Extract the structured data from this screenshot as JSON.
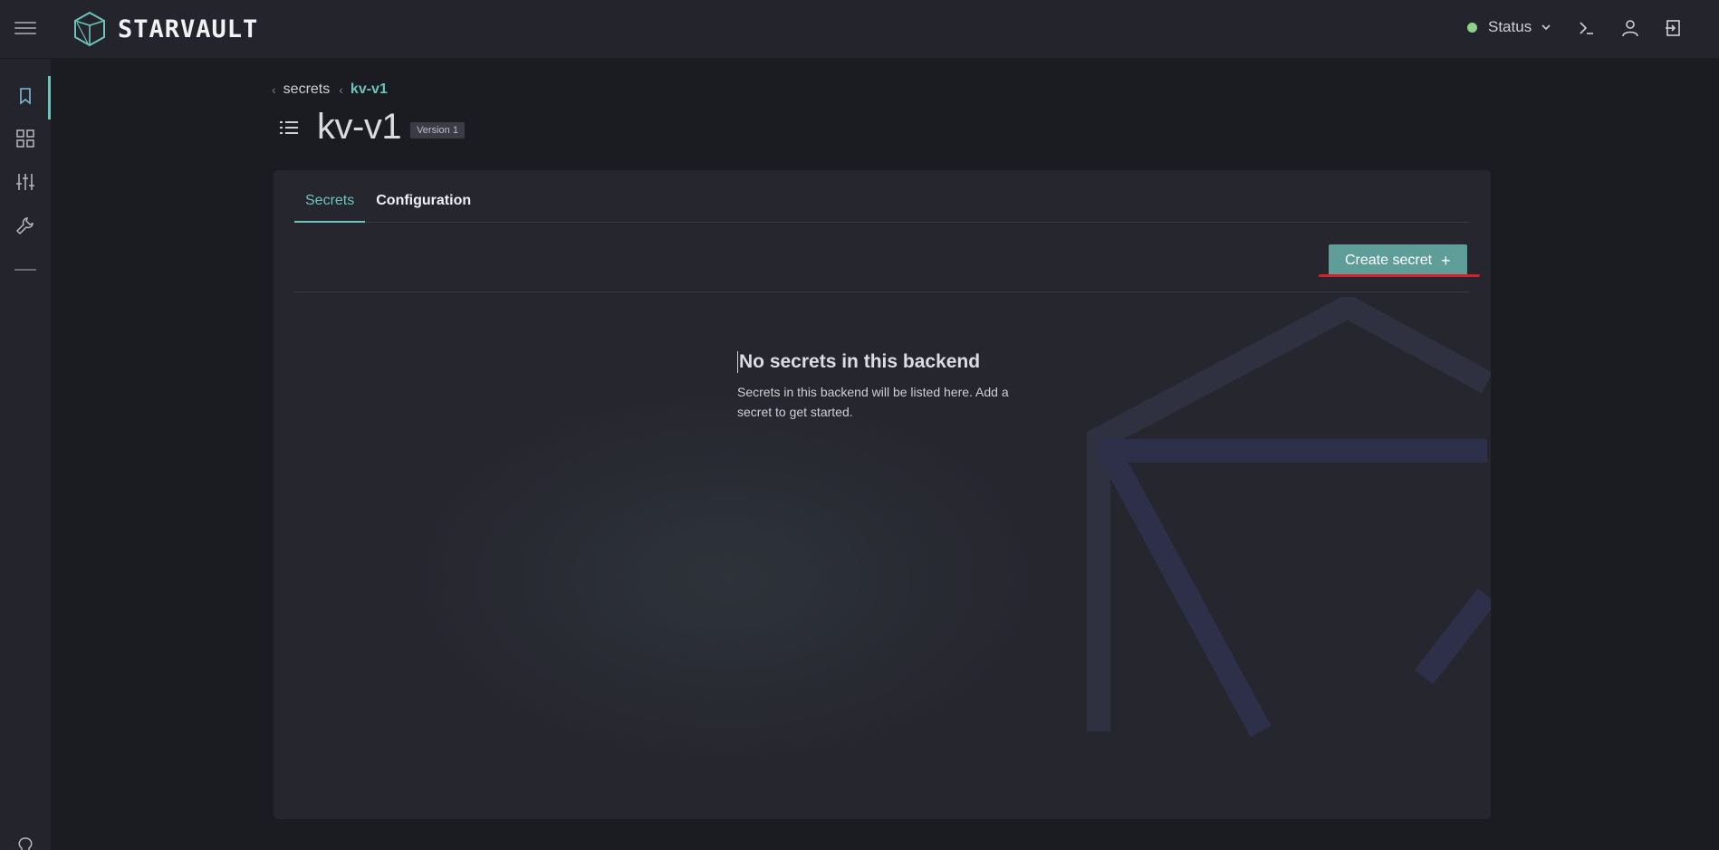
{
  "app": {
    "name": "STARVAULT"
  },
  "header": {
    "status_label": "Status",
    "status_color": "#8fd18a",
    "icons": [
      "menu-icon",
      "terminal-icon",
      "user-icon",
      "logout-icon"
    ]
  },
  "sidebar": {
    "items": [
      {
        "icon": "bookmark-icon",
        "active": true
      },
      {
        "icon": "grid-icon",
        "active": false
      },
      {
        "icon": "sliders-icon",
        "active": false
      },
      {
        "icon": "wrench-icon",
        "active": false
      }
    ],
    "bottom_icon": "lightbulb-icon"
  },
  "breadcrumb": {
    "items": [
      "secrets",
      "kv-v1"
    ]
  },
  "page": {
    "title": "kv-v1",
    "version_badge": "Version 1"
  },
  "tabs": [
    {
      "label": "Secrets",
      "active": true
    },
    {
      "label": "Configuration",
      "active": false
    }
  ],
  "toolbar": {
    "create_label": "Create secret",
    "create_plus": "+"
  },
  "empty_state": {
    "title": "No secrets in this backend",
    "line1": "Secrets in this backend will be listed here. Add a",
    "line2": "secret to get started."
  },
  "colors": {
    "accent": "#6ec2bc",
    "button": "#5f9e98",
    "highlight": "#d4202a"
  }
}
